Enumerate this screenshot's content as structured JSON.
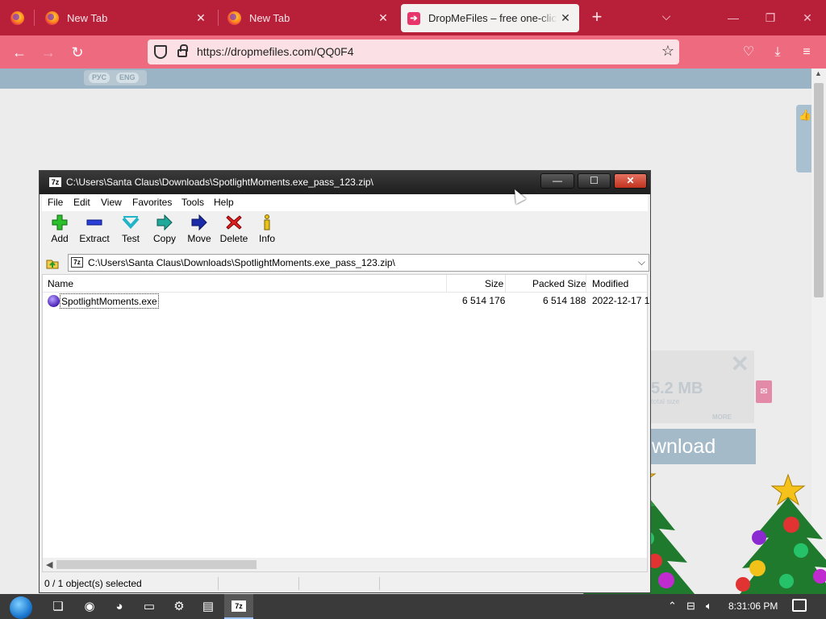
{
  "browser": {
    "tabs": [
      {
        "title": "New Tab"
      },
      {
        "title": "New Tab"
      },
      {
        "title": "DropMeFiles – free one-click file sharing"
      }
    ],
    "url": "https://dropmefiles.com/QQ0F4"
  },
  "webpage": {
    "langs": [
      "РУС",
      "ENG"
    ],
    "size_text": "5.2 MB",
    "size_sub": "total size",
    "more_label": "MORE",
    "download_label": "wnload"
  },
  "zip": {
    "title": "C:\\Users\\Santa Claus\\Downloads\\SpotlightMoments.exe_pass_123.zip\\",
    "app_icon": "7z",
    "menu": [
      "File",
      "Edit",
      "View",
      "Favorites",
      "Tools",
      "Help"
    ],
    "toolbar": [
      "Add",
      "Extract",
      "Test",
      "Copy",
      "Move",
      "Delete",
      "Info"
    ],
    "path": "C:\\Users\\Santa Claus\\Downloads\\SpotlightMoments.exe_pass_123.zip\\",
    "columns": [
      "Name",
      "Size",
      "Packed Size",
      "Modified"
    ],
    "files": [
      {
        "name": "SpotlightMoments.exe",
        "size": "6 514 176",
        "packed": "6 514 188",
        "modified": "2022-12-17 1"
      }
    ],
    "status": "0 / 1 object(s) selected",
    "title_buttons": {
      "minimize": "—",
      "maximize": "☐",
      "close": "✕"
    }
  },
  "taskbar": {
    "clock": "8:31:06 PM",
    "tb_7z": "7z"
  },
  "icons": {
    "accent": "#b8203a",
    "toolbar_bar": "#ee6a7f"
  }
}
